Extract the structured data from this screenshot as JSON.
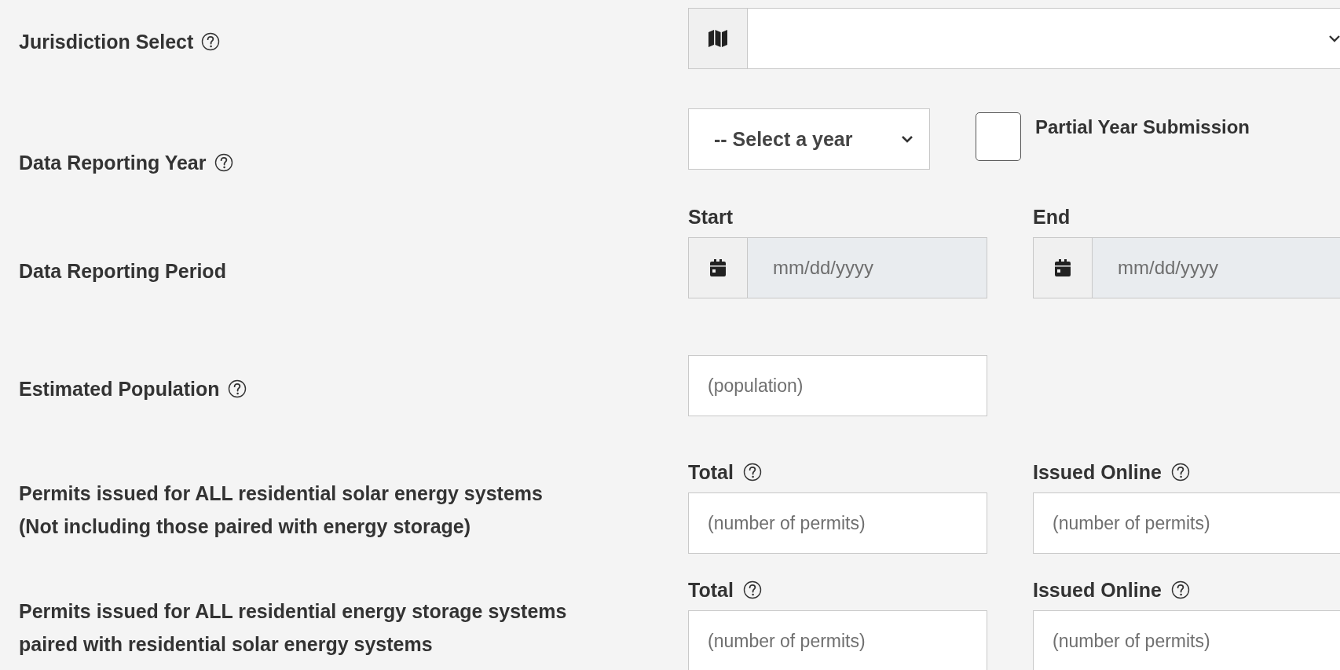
{
  "rows": [
    {
      "kind": "icon_select",
      "label": [
        "Jurisdiction Select"
      ],
      "help": true
    },
    {
      "kind": "year",
      "label": [
        "Data Reporting Year"
      ],
      "help": true,
      "select": {
        "value": "-- Select a year"
      },
      "checkbox": {
        "label": "Partial Year Submission",
        "checked": false
      }
    },
    {
      "kind": "dates",
      "label": [
        "Data Reporting Period"
      ],
      "help": false,
      "fields": [
        {
          "heading": "Start",
          "help": false,
          "placeholder": "mm/dd/yyyy",
          "disabled": true
        },
        {
          "heading": "End",
          "help": false,
          "placeholder": "mm/dd/yyyy",
          "disabled": true
        }
      ]
    },
    {
      "kind": "fields",
      "label": [
        "Estimated Population"
      ],
      "help": true,
      "fields": [
        {
          "placeholder": "(population)",
          "disabled": false
        }
      ]
    },
    {
      "kind": "fields",
      "label": [
        "Permits issued for ALL residential solar energy systems",
        "(Not including those paired with energy storage)"
      ],
      "help": false,
      "fields": [
        {
          "heading": "Total",
          "help": true,
          "placeholder": "(number of permits)",
          "disabled": false
        },
        {
          "heading": "Issued Online",
          "help": true,
          "placeholder": "(number of permits)",
          "disabled": false
        }
      ]
    },
    {
      "kind": "fields",
      "label": [
        "Permits issued for ALL residential energy storage systems",
        "paired with residential solar energy systems"
      ],
      "help": false,
      "fields": [
        {
          "heading": "Total",
          "help": true,
          "placeholder": "(number of permits)",
          "disabled": false
        },
        {
          "heading": "Issued Online",
          "help": true,
          "placeholder": "(number of permits)",
          "disabled": false
        }
      ]
    }
  ]
}
